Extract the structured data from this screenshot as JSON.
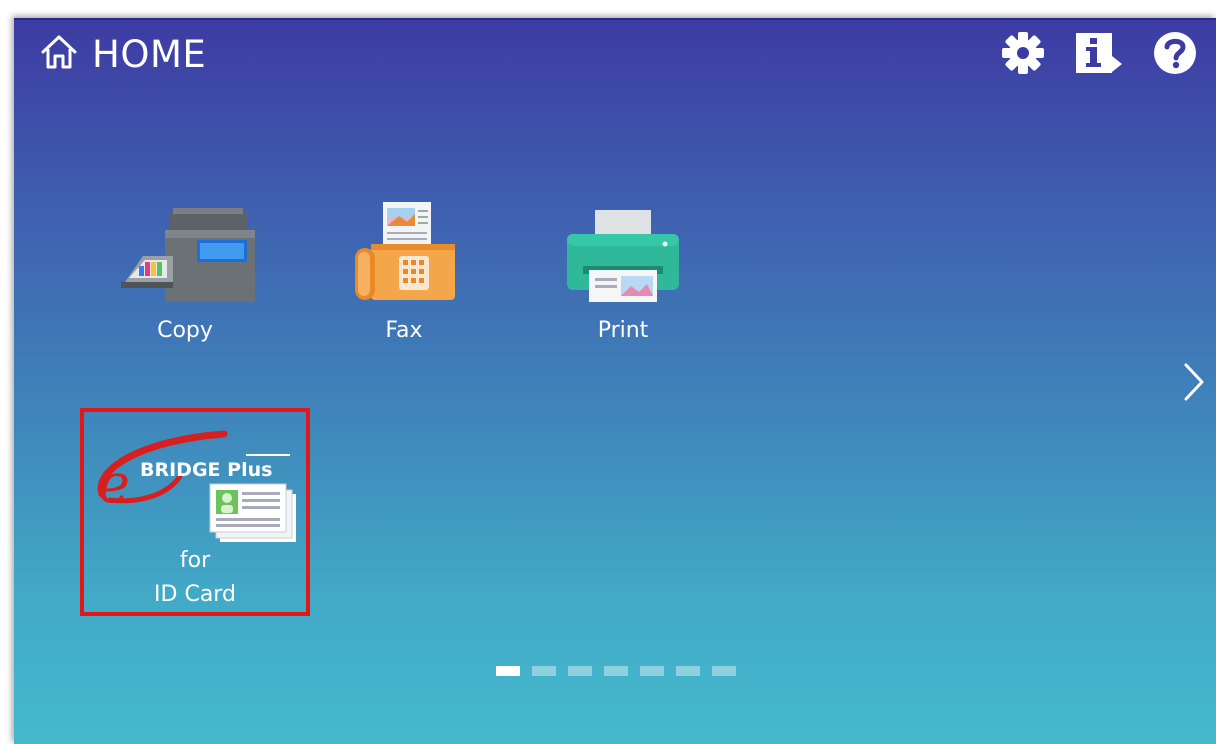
{
  "header": {
    "title": "HOME",
    "icons": [
      "home-icon",
      "gear-icon",
      "info-icon",
      "help-icon"
    ]
  },
  "apps": [
    {
      "label": "Copy",
      "icon": "copier-icon"
    },
    {
      "label": "Fax",
      "icon": "fax-icon"
    },
    {
      "label": "Print",
      "icon": "printer-icon"
    },
    {
      "label_line1": "for",
      "label_line2": "ID Card",
      "logo_text": "BRIDGE Plus",
      "logo_prefix": "e",
      "icon": "e-bridge-id-card-icon",
      "selected_highlight": "#e21818"
    }
  ],
  "pagination": {
    "total": 7,
    "current": 1
  },
  "colors": {
    "background_top": "#3d3ba3",
    "background_bottom": "#45b9cc",
    "highlight": "#e21818"
  }
}
